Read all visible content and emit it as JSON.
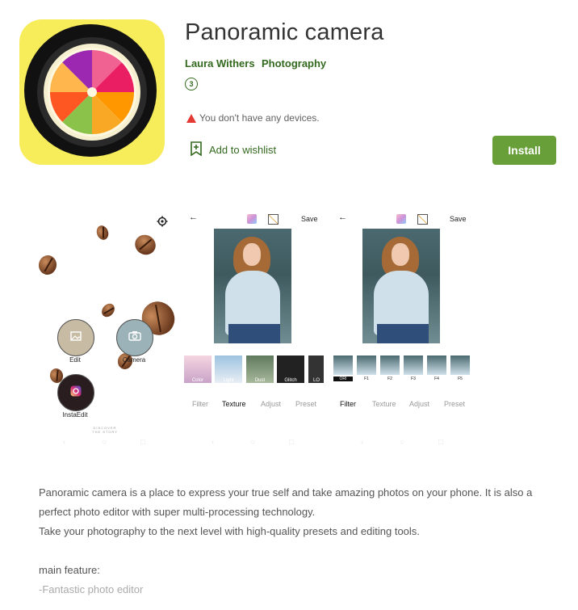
{
  "app": {
    "title": "Panoramic camera",
    "developer": "Laura Withers",
    "category": "Photography",
    "rating_badge": "3",
    "device_warning": "You don't have any devices.",
    "wishlist_label": "Add to wishlist",
    "install_label": "Install"
  },
  "screenshot1": {
    "edit_label": "Edit",
    "camera_label": "Camera",
    "instaedit_label": "InstaEdit",
    "tagline": "DISCOVER THE STORY"
  },
  "screenshot2": {
    "save_label": "Save",
    "filters": [
      "Color",
      "Light",
      "Dust",
      "Glitch",
      "LO"
    ],
    "tabs": [
      "Filter",
      "Texture",
      "Adjust",
      "Preset"
    ],
    "active_tab": "Texture"
  },
  "screenshot3": {
    "save_label": "Save",
    "presets": [
      "ORI",
      "F1",
      "F2",
      "F3",
      "F4",
      "F5"
    ],
    "tabs": [
      "Filter",
      "Texture",
      "Adjust",
      "Preset"
    ],
    "active_tab": "Filter"
  },
  "description": {
    "para1": "Panoramic camera is a place to express your true self and take amazing photos on your phone. It is also a perfect photo editor with super multi-processing technology.",
    "para2": "Take your photography to the next level with high-quality presets and editing tools.",
    "heading": "main feature:",
    "feature1": "-Fantastic photo editor"
  },
  "colors": {
    "accent_green": "#689f38",
    "link_green": "#33691e",
    "warning_red": "#e53935",
    "icon_yellow": "#f7ec5a"
  },
  "icons": [
    "warning-icon",
    "bookmark-plus-icon",
    "gear-icon",
    "back-arrow-icon",
    "cube-icon",
    "brush-icon",
    "image-icon",
    "camera-icon",
    "instagram-icon"
  ]
}
